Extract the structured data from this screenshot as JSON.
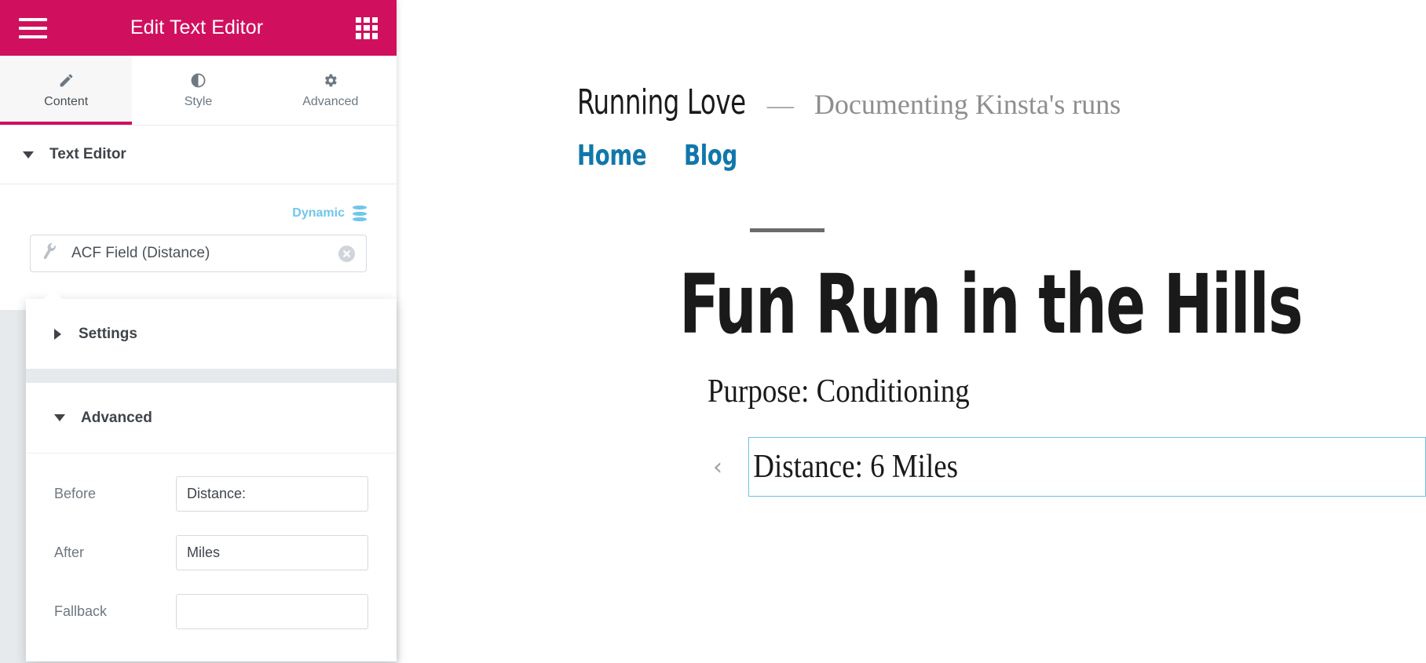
{
  "panel": {
    "header": {
      "title": "Edit Text Editor",
      "menu_icon": "hamburger-menu-icon",
      "apps_icon": "grid-apps-icon"
    },
    "tabs": [
      {
        "label": "Content",
        "icon": "pencil-icon",
        "glyph": "✎",
        "active": true
      },
      {
        "label": "Style",
        "icon": "contrast-half-circle-icon",
        "glyph": "◐",
        "active": false
      },
      {
        "label": "Advanced",
        "icon": "gear-icon",
        "glyph": "⚙",
        "active": false
      }
    ],
    "section": {
      "title": "Text Editor",
      "expanded": true
    },
    "dynamic": {
      "label": "Dynamic",
      "icon": "database-stack-icon",
      "field_value": "ACF Field (Distance)",
      "field_icon": "wrench-icon",
      "clear_icon": "clear-circle-x-icon",
      "clear_glyph": "✖"
    }
  },
  "popup": {
    "settings": {
      "title": "Settings",
      "expanded": false
    },
    "advanced": {
      "title": "Advanced",
      "expanded": true,
      "fields": [
        {
          "label": "Before",
          "value": "Distance:",
          "placeholder": ""
        },
        {
          "label": "After",
          "value": "Miles",
          "placeholder": ""
        },
        {
          "label": "Fallback",
          "value": "",
          "placeholder": ""
        }
      ]
    }
  },
  "preview": {
    "site_title": "Running Love",
    "site_dash": "—",
    "site_tagline": "Documenting Kinsta's runs",
    "nav": [
      {
        "label": "Home"
      },
      {
        "label": "Blog"
      }
    ],
    "post": {
      "title": "Fun Run in the Hills",
      "meta": "Purpose: Conditioning",
      "widget_text": "Distance: 6 Miles"
    },
    "collapse_handle_glyph": "‹",
    "collapse_handle_icon": "chevron-left-icon"
  },
  "colors": {
    "brand_pink": "#d0105e",
    "accent_cyan": "#6ec1e4",
    "link_blue": "#1177aa",
    "panel_bg": "#e7eaec"
  }
}
